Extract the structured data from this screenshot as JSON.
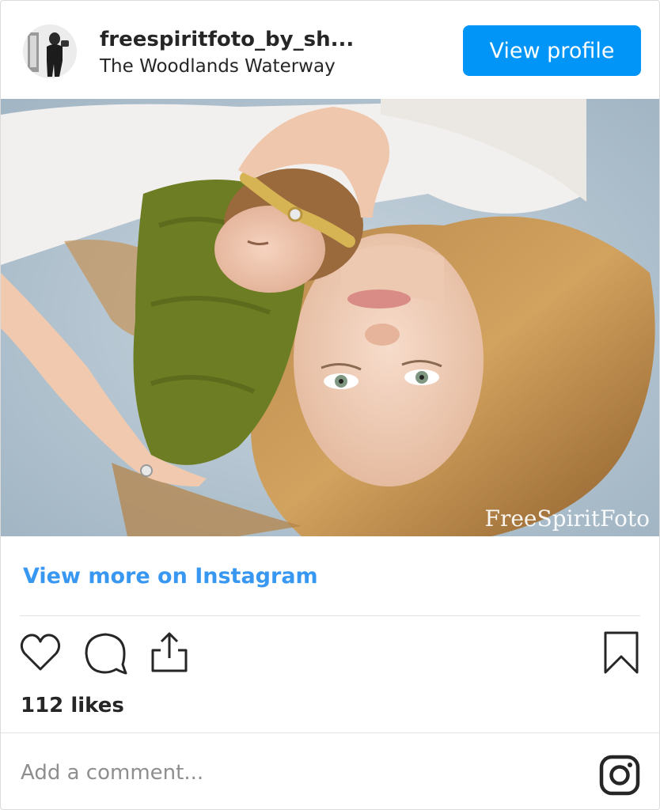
{
  "header": {
    "username": "freespiritfoto_by_sh...",
    "location": "The Woodlands Waterway",
    "view_profile_label": "View profile"
  },
  "photo": {
    "watermark": "FreeSpiritFoto"
  },
  "view_more_label": "View more on Instagram",
  "actions": {
    "like_icon": "heart-icon",
    "comment_icon": "comment-icon",
    "share_icon": "share-icon",
    "save_icon": "bookmark-icon"
  },
  "likes_text": "112 likes",
  "comment": {
    "placeholder": "Add a comment..."
  },
  "colors": {
    "primary_button": "#0095f6",
    "link": "#3897f0",
    "text": "#262626",
    "muted": "#8e8e8e"
  }
}
